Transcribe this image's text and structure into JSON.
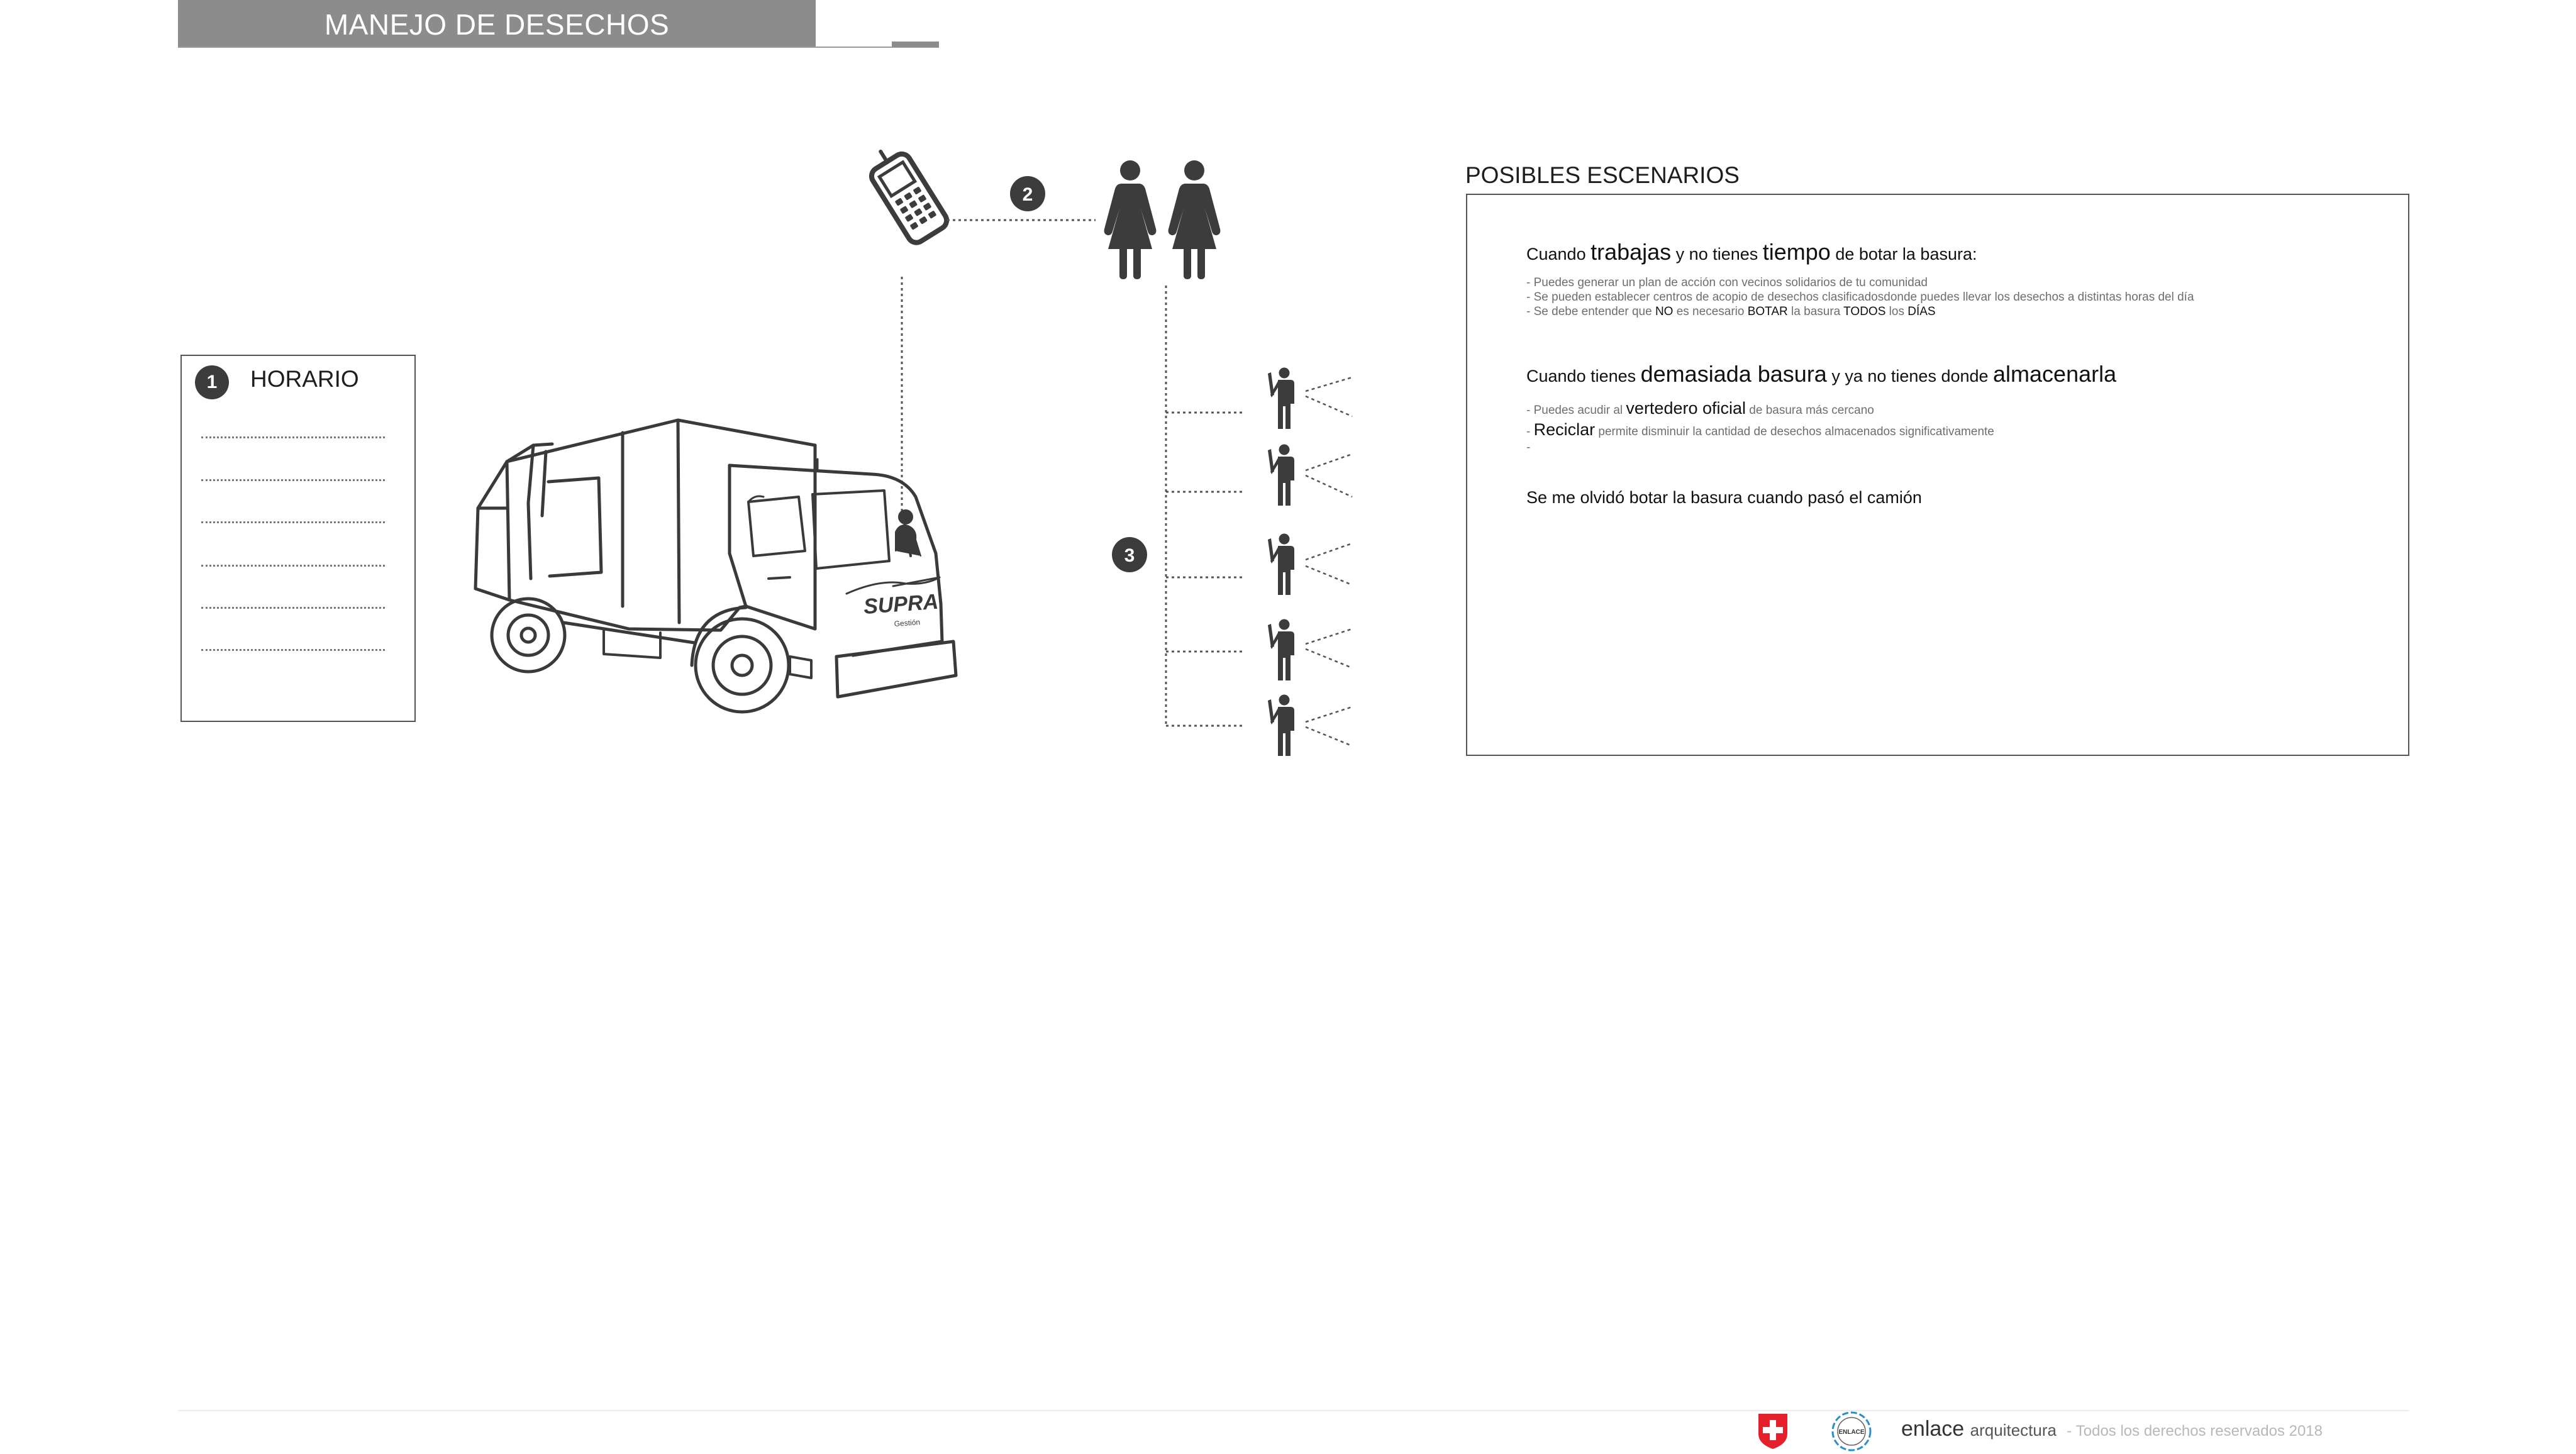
{
  "header": {
    "title": "MANEJO DE DESECHOS"
  },
  "schedule": {
    "step": "1",
    "title": "HORARIO"
  },
  "diagram": {
    "step_call": "2",
    "step_broadcast": "3",
    "truck_brand": "SUPRA",
    "truck_brand_sub": "Gestión"
  },
  "scenarios": {
    "title": "POSIBLES ESCENARIOS",
    "s1": {
      "p1": "Cuando ",
      "k1": "trabajas",
      "p2": " y no tienes ",
      "k2": "tiempo",
      "p3": " de botar la basura:",
      "tip1": "- Puedes generar un plan de acción con vecinos solidarios de tu comunidad",
      "tip2": "- Se pueden establecer centros de acopio de desechos clasificadosdonde puedes llevar los desechos a distintas horas del día",
      "tip3a": "- Se debe entender que ",
      "tip3b": "NO",
      "tip3c": " es necesario ",
      "tip3d": "BOTAR",
      "tip3e": " la basura ",
      "tip3f": "TODOS",
      "tip3g": " los ",
      "tip3h": "DÍAS"
    },
    "s2": {
      "p1": "Cuando tienes ",
      "k1": "demasiada basura",
      "p2": " y ya no tienes donde ",
      "k2": "almacenarla",
      "tip1a": "- Puedes acudir al ",
      "tip1b": "vertedero oficial",
      "tip1c": " de basura más cercano",
      "tip2a": "- ",
      "tip2b": "Reciclar",
      "tip2c": " permite disminuir la cantidad de desechos almacenados significativamente",
      "tip3": "-"
    },
    "s3": {
      "text": "Se me olvidó botar la basura cuando pasó el camión"
    }
  },
  "footer": {
    "brand": "enlace",
    "brand_sub": "arquitectura",
    "separator": "-",
    "rights": "Todos los derechos reservados 2018",
    "logo2": "ENLACE"
  },
  "colors": {
    "header_bg": "#8c8c8c",
    "icon": "#3c3c3c",
    "swiss_red": "#e4202c",
    "logo_blue": "#2a8fc9"
  },
  "icons": [
    "mobile-phone-icon",
    "woman-icon",
    "person-phone-icon",
    "swiss-cross-icon",
    "garbage-truck-illustration"
  ]
}
